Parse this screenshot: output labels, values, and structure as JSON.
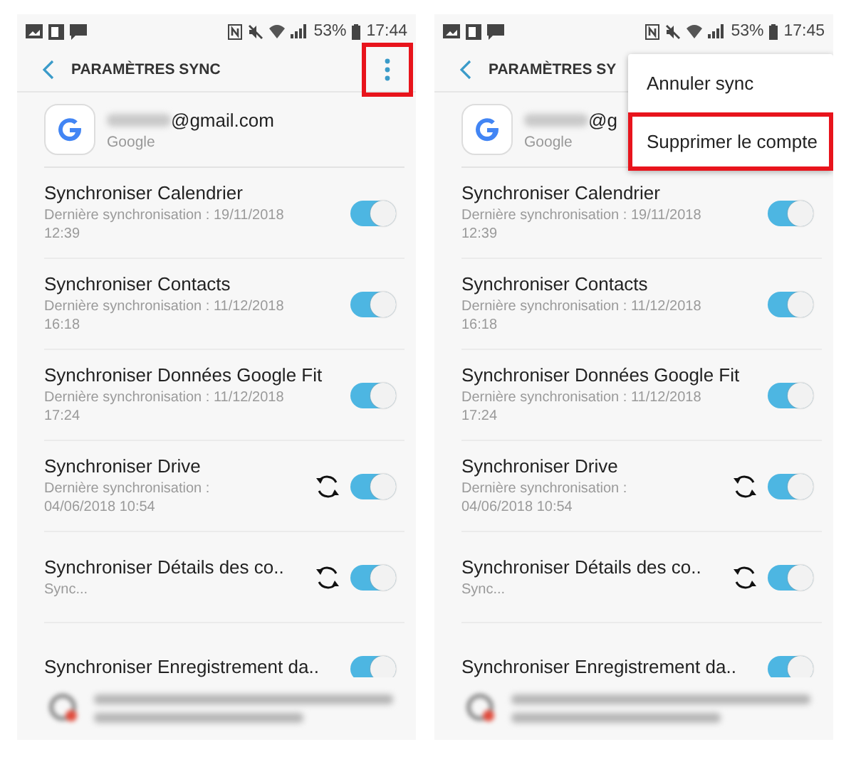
{
  "screens": [
    {
      "status": {
        "battery": "53%",
        "time": "17:44"
      },
      "title": "PARAMÈTRES SYNC",
      "menu_button": {
        "highlighted": true
      },
      "account": {
        "email": "@gmail.com",
        "provider": "Google"
      },
      "items": [
        {
          "kind": "toggle",
          "title": "Synchroniser Calendrier",
          "subtitle": [
            "Dernière synchronisation : 19/11/2018",
            "12:39"
          ],
          "on": true,
          "syncing": false
        },
        {
          "kind": "toggle",
          "title": "Synchroniser Contacts",
          "subtitle": [
            "Dernière synchronisation : 11/12/2018",
            "16:18"
          ],
          "on": true,
          "syncing": false
        },
        {
          "kind": "toggle",
          "title": "Synchroniser Données Google Fit",
          "subtitle": [
            "Dernière synchronisation : 11/12/2018",
            "17:24"
          ],
          "on": true,
          "syncing": false
        },
        {
          "kind": "toggle",
          "title": "Synchroniser Drive",
          "subtitle": [
            "Dernière synchronisation :",
            "04/06/2018  10:54"
          ],
          "on": true,
          "syncing": true
        },
        {
          "kind": "toggle",
          "title": "Synchroniser Détails des co..",
          "subtitle": [
            "Sync..."
          ],
          "on": true,
          "syncing": true
        },
        {
          "kind": "toggle",
          "title": "Synchroniser Enregistrement da..",
          "on": true,
          "syncing": false
        }
      ]
    },
    {
      "status": {
        "battery": "53%",
        "time": "17:45"
      },
      "title": "PARAMÈTRES SY",
      "account": {
        "email": "@g",
        "provider": "Google"
      },
      "menu": [
        {
          "label": "Annuler sync",
          "highlighted": false
        },
        {
          "label": "Supprimer le compte",
          "highlighted": true
        }
      ],
      "items": [
        {
          "kind": "toggle",
          "title": "Synchroniser Calendrier",
          "subtitle": [
            "Dernière synchronisation : 19/11/2018",
            "12:39"
          ],
          "on": true,
          "syncing": false
        },
        {
          "kind": "toggle",
          "title": "Synchroniser Contacts",
          "subtitle": [
            "Dernière synchronisation : 11/12/2018",
            "16:18"
          ],
          "on": true,
          "syncing": false
        },
        {
          "kind": "toggle",
          "title": "Synchroniser Données Google Fit",
          "subtitle": [
            "Dernière synchronisation : 11/12/2018",
            "17:24"
          ],
          "on": true,
          "syncing": false
        },
        {
          "kind": "toggle",
          "title": "Synchroniser Drive",
          "subtitle": [
            "Dernière synchronisation :",
            "04/06/2018  10:54"
          ],
          "on": true,
          "syncing": true
        },
        {
          "kind": "toggle",
          "title": "Synchroniser Détails des co..",
          "subtitle": [
            "Sync..."
          ],
          "on": true,
          "syncing": true
        },
        {
          "kind": "toggle",
          "title": "Synchroniser Enregistrement da..",
          "on": true,
          "syncing": false
        }
      ]
    }
  ]
}
